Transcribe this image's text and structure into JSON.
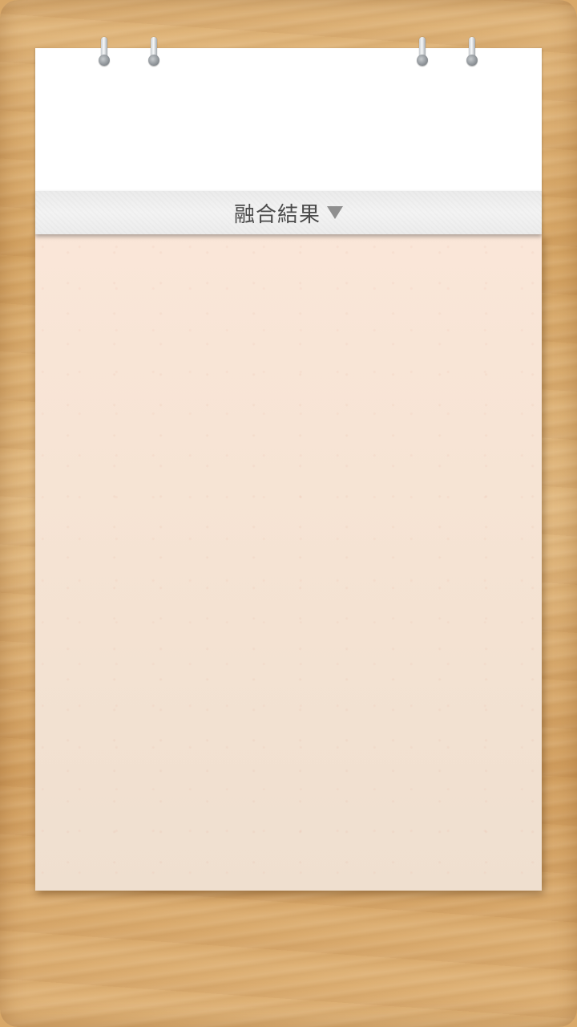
{
  "header": {
    "title": "融合結果"
  }
}
